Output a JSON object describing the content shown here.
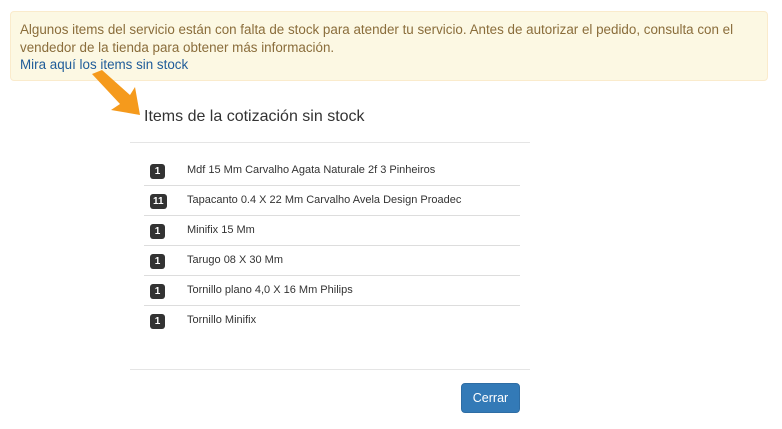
{
  "alert": {
    "message": "Algunos items del servicio están con falta de stock para atender tu servicio. Antes de autorizar el pedido, consulta con el vendedor de la tienda para obtener más información.",
    "link_text": "Mira aquí los items sin stock"
  },
  "colors": {
    "alert_bg": "#fcf8e3",
    "alert_text": "#8a6d3b",
    "link": "#1f5c99",
    "arrow": "#f59a1c",
    "badge_bg": "#333333",
    "primary_button": "#337ab7"
  },
  "annotation": {
    "icon": "arrow-icon"
  },
  "modal": {
    "title": "Items de la cotización sin stock",
    "items": [
      {
        "qty": "1",
        "name": "Mdf 15 Mm Carvalho Agata Naturale 2f 3 Pinheiros"
      },
      {
        "qty": "11",
        "name": "Tapacanto 0.4 X 22 Mm Carvalho Avela Design Proadec"
      },
      {
        "qty": "1",
        "name": "Minifix 15 Mm"
      },
      {
        "qty": "1",
        "name": "Tarugo 08 X 30 Mm"
      },
      {
        "qty": "1",
        "name": "Tornillo plano 4,0 X 16 Mm Philips"
      },
      {
        "qty": "1",
        "name": "Tornillo Minifix"
      }
    ],
    "close_label": "Cerrar"
  }
}
